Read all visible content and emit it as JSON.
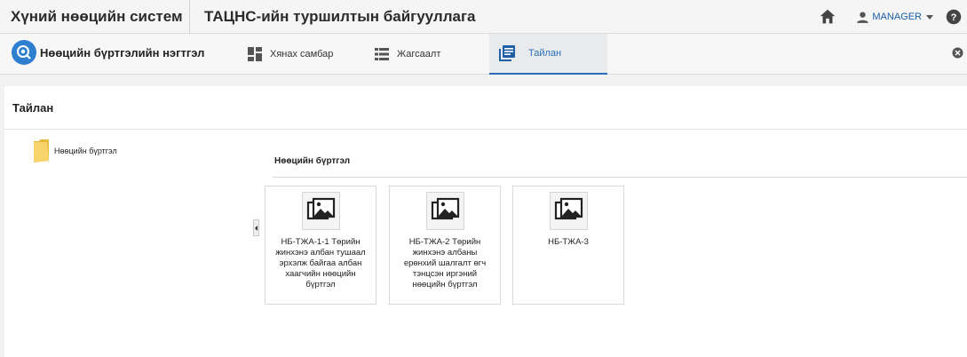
{
  "header": {
    "app_title": "Хүний нөөцийн систем",
    "org_title": "ТАЦНС-ийн туршилтын байгууллага",
    "user_name": "MANAGER"
  },
  "nav": {
    "module_title": "Нөөцийн бүртгэлийн нэгтгэл",
    "tabs": [
      {
        "label": "Хянах самбар",
        "icon": "dashboard-icon"
      },
      {
        "label": "Жагсаалт",
        "icon": "list-icon"
      },
      {
        "label": "Тайлан",
        "icon": "report-icon",
        "active": true
      }
    ]
  },
  "page": {
    "title": "Тайлан"
  },
  "tree": {
    "items": [
      {
        "label": "Нөөцийн бүртгэл",
        "icon": "folder-icon"
      }
    ]
  },
  "group": {
    "title": "Нөөцийн бүртгэл",
    "cards": [
      {
        "label": "НБ-ТЖА-1-1 Төрийн жинхэнэ албан тушаал эрхэлж байгаа албан хаагчийн нөөцийн бүртгэл",
        "icon": "image-icon"
      },
      {
        "label": "НБ-ТЖА-2 Төрийн жинхэнэ албаны ерөнхий шалгалт өгч тэнцсэн иргэний нөөцийн бүртгэл",
        "icon": "image-icon"
      },
      {
        "label": "НБ-ТЖА-3",
        "icon": "image-icon"
      }
    ]
  },
  "colors": {
    "accent": "#2a6ebb",
    "module_icon_bg": "#2f7fd1",
    "folder": "#f2c94c"
  }
}
